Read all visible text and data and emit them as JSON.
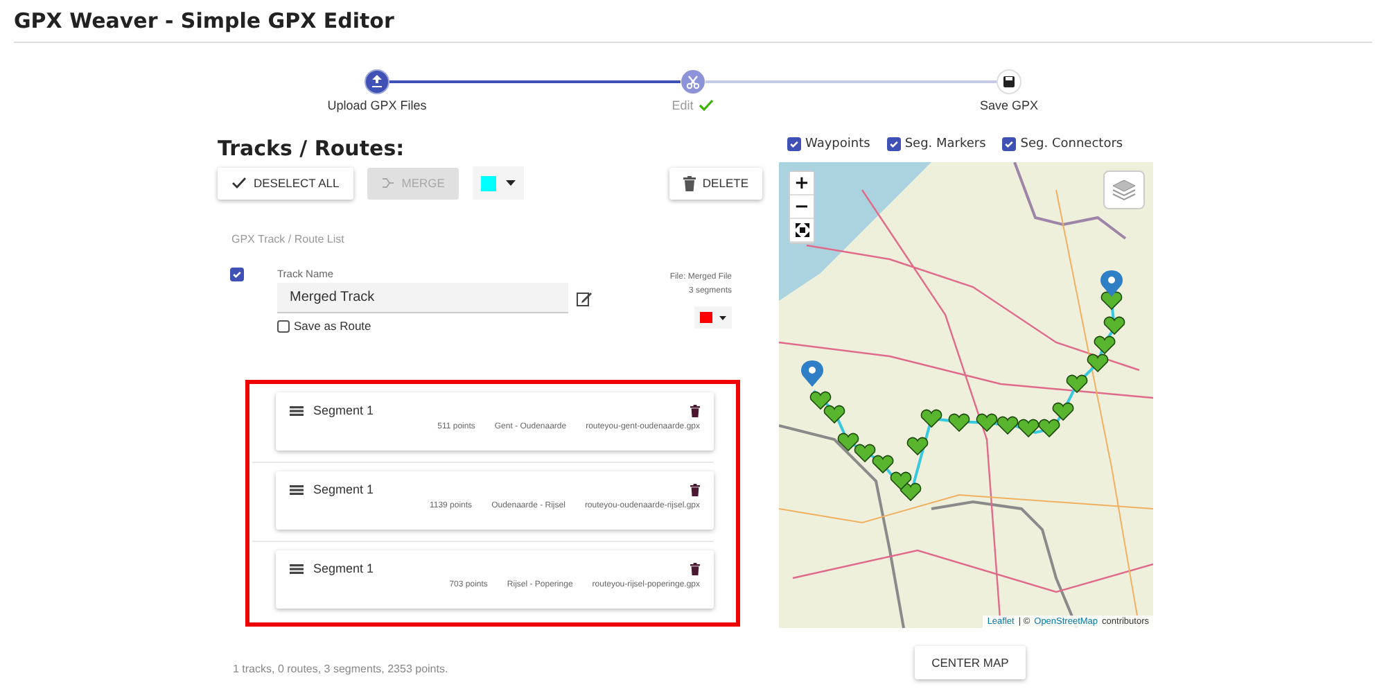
{
  "app": {
    "title": "GPX Weaver - Simple GPX Editor"
  },
  "stepper": [
    {
      "label": "Upload GPX Files",
      "kind": "completed",
      "done": false
    },
    {
      "label": "Edit",
      "kind": "active",
      "done": true
    },
    {
      "label": "Save GPX",
      "kind": "pending",
      "done": false
    }
  ],
  "tracks_panel": {
    "heading": "Tracks / Routes:",
    "toolbar": {
      "deselect_label": "DESELECT ALL",
      "merge": {
        "label": "MERGE",
        "disabled": true
      },
      "color": "#00ffff",
      "delete_label": "DELETE"
    },
    "list_title": "GPX Track / Route List",
    "tracks": [
      {
        "checked": true,
        "field_label": "Track Name",
        "name": "Merged Track",
        "save_as_route_label": "Save as Route",
        "save_as_route": false,
        "file": "File: Merged File",
        "segment_count": "3 segments",
        "color": "#ff0000",
        "segments": [
          {
            "name": "Segment 1",
            "points": "511 points",
            "title": "Gent - Oudenaarde",
            "file": "routeyou-gent-oudenaarde.gpx"
          },
          {
            "name": "Segment 1",
            "points": "1139 points",
            "title": "Oudenaarde - Rijsel",
            "file": "routeyou-oudenaarde-rijsel.gpx"
          },
          {
            "name": "Segment 1",
            "points": "703 points",
            "title": "Rijsel - Poperinge",
            "file": "routeyou-rijsel-poperinge.gpx"
          }
        ]
      }
    ],
    "summary": "1 tracks, 0 routes, 3 segments, 2353 points."
  },
  "map_panel": {
    "layers": [
      {
        "label": "Waypoints",
        "checked": true
      },
      {
        "label": "Seg. Markers",
        "checked": true
      },
      {
        "label": "Seg. Connectors",
        "checked": true
      }
    ],
    "zoom_in": "+",
    "zoom_out": "−",
    "attribution": {
      "leaflet": "Leaflet",
      "separator": "| ©",
      "osm": "OpenStreetMap",
      "suffix": "contributors"
    },
    "center_button": "CENTER MAP"
  }
}
